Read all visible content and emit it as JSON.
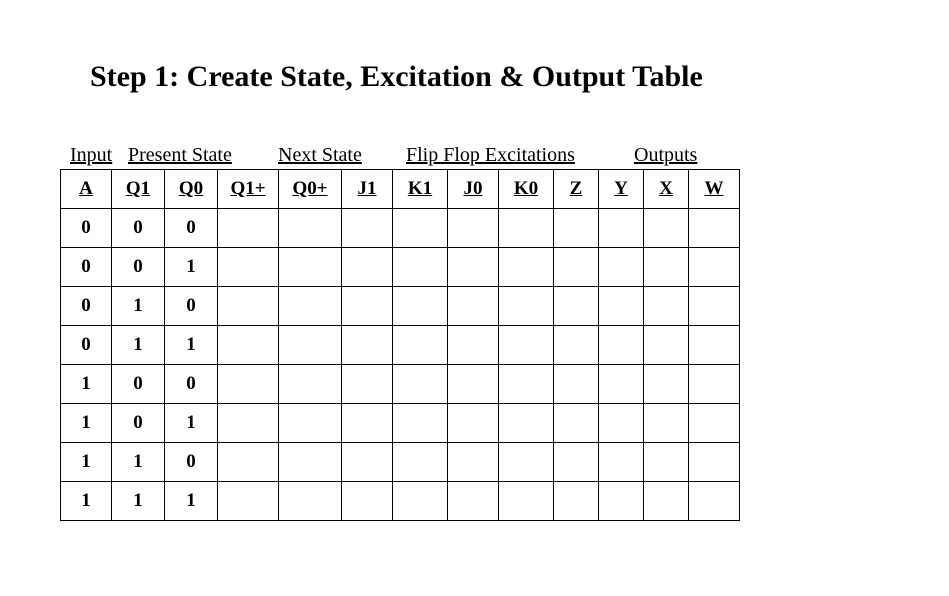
{
  "title": "Step 1: Create State, Excitation & Output Table",
  "sections": {
    "input": "Input",
    "present": "Present State",
    "next": "Next State",
    "flip": "Flip Flop Excitations",
    "out": "Outputs"
  },
  "columns": {
    "a": "A",
    "q1": "Q1",
    "q0": "Q0",
    "q1p": "Q1+",
    "q0p": "Q0+",
    "j1": "J1",
    "k1": "K1",
    "j0": "J0",
    "k0": "K0",
    "z": "Z",
    "y": "Y",
    "x": "X",
    "w": "W"
  },
  "rows": [
    {
      "a": "0",
      "q1": "0",
      "q0": "0",
      "q1p": "",
      "q0p": "",
      "j1": "",
      "k1": "",
      "j0": "",
      "k0": "",
      "z": "",
      "y": "",
      "x": "",
      "w": ""
    },
    {
      "a": "0",
      "q1": "0",
      "q0": "1",
      "q1p": "",
      "q0p": "",
      "j1": "",
      "k1": "",
      "j0": "",
      "k0": "",
      "z": "",
      "y": "",
      "x": "",
      "w": ""
    },
    {
      "a": "0",
      "q1": "1",
      "q0": "0",
      "q1p": "",
      "q0p": "",
      "j1": "",
      "k1": "",
      "j0": "",
      "k0": "",
      "z": "",
      "y": "",
      "x": "",
      "w": ""
    },
    {
      "a": "0",
      "q1": "1",
      "q0": "1",
      "q1p": "",
      "q0p": "",
      "j1": "",
      "k1": "",
      "j0": "",
      "k0": "",
      "z": "",
      "y": "",
      "x": "",
      "w": ""
    },
    {
      "a": "1",
      "q1": "0",
      "q0": "0",
      "q1p": "",
      "q0p": "",
      "j1": "",
      "k1": "",
      "j0": "",
      "k0": "",
      "z": "",
      "y": "",
      "x": "",
      "w": ""
    },
    {
      "a": "1",
      "q1": "0",
      "q0": "1",
      "q1p": "",
      "q0p": "",
      "j1": "",
      "k1": "",
      "j0": "",
      "k0": "",
      "z": "",
      "y": "",
      "x": "",
      "w": ""
    },
    {
      "a": "1",
      "q1": "1",
      "q0": "0",
      "q1p": "",
      "q0p": "",
      "j1": "",
      "k1": "",
      "j0": "",
      "k0": "",
      "z": "",
      "y": "",
      "x": "",
      "w": ""
    },
    {
      "a": "1",
      "q1": "1",
      "q0": "1",
      "q1p": "",
      "q0p": "",
      "j1": "",
      "k1": "",
      "j0": "",
      "k0": "",
      "z": "",
      "y": "",
      "x": "",
      "w": ""
    }
  ],
  "chart_data": {
    "type": "table",
    "title": "State, Excitation & Output Table",
    "column_groups": [
      {
        "label": "Input",
        "cols": [
          "A"
        ]
      },
      {
        "label": "Present State",
        "cols": [
          "Q1",
          "Q0"
        ]
      },
      {
        "label": "Next State",
        "cols": [
          "Q1+",
          "Q0+"
        ]
      },
      {
        "label": "Flip Flop Excitations",
        "cols": [
          "J1",
          "K1",
          "J0",
          "K0"
        ]
      },
      {
        "label": "Outputs",
        "cols": [
          "Z",
          "Y",
          "X",
          "W"
        ]
      }
    ],
    "columns": [
      "A",
      "Q1",
      "Q0",
      "Q1+",
      "Q0+",
      "J1",
      "K1",
      "J0",
      "K0",
      "Z",
      "Y",
      "X",
      "W"
    ],
    "rows": [
      [
        "0",
        "0",
        "0",
        "",
        "",
        "",
        "",
        "",
        "",
        "",
        "",
        "",
        ""
      ],
      [
        "0",
        "0",
        "1",
        "",
        "",
        "",
        "",
        "",
        "",
        "",
        "",
        "",
        ""
      ],
      [
        "0",
        "1",
        "0",
        "",
        "",
        "",
        "",
        "",
        "",
        "",
        "",
        "",
        ""
      ],
      [
        "0",
        "1",
        "1",
        "",
        "",
        "",
        "",
        "",
        "",
        "",
        "",
        "",
        ""
      ],
      [
        "1",
        "0",
        "0",
        "",
        "",
        "",
        "",
        "",
        "",
        "",
        "",
        "",
        ""
      ],
      [
        "1",
        "0",
        "1",
        "",
        "",
        "",
        "",
        "",
        "",
        "",
        "",
        "",
        ""
      ],
      [
        "1",
        "1",
        "0",
        "",
        "",
        "",
        "",
        "",
        "",
        "",
        "",
        "",
        ""
      ],
      [
        "1",
        "1",
        "1",
        "",
        "",
        "",
        "",
        "",
        "",
        "",
        "",
        "",
        ""
      ]
    ]
  }
}
